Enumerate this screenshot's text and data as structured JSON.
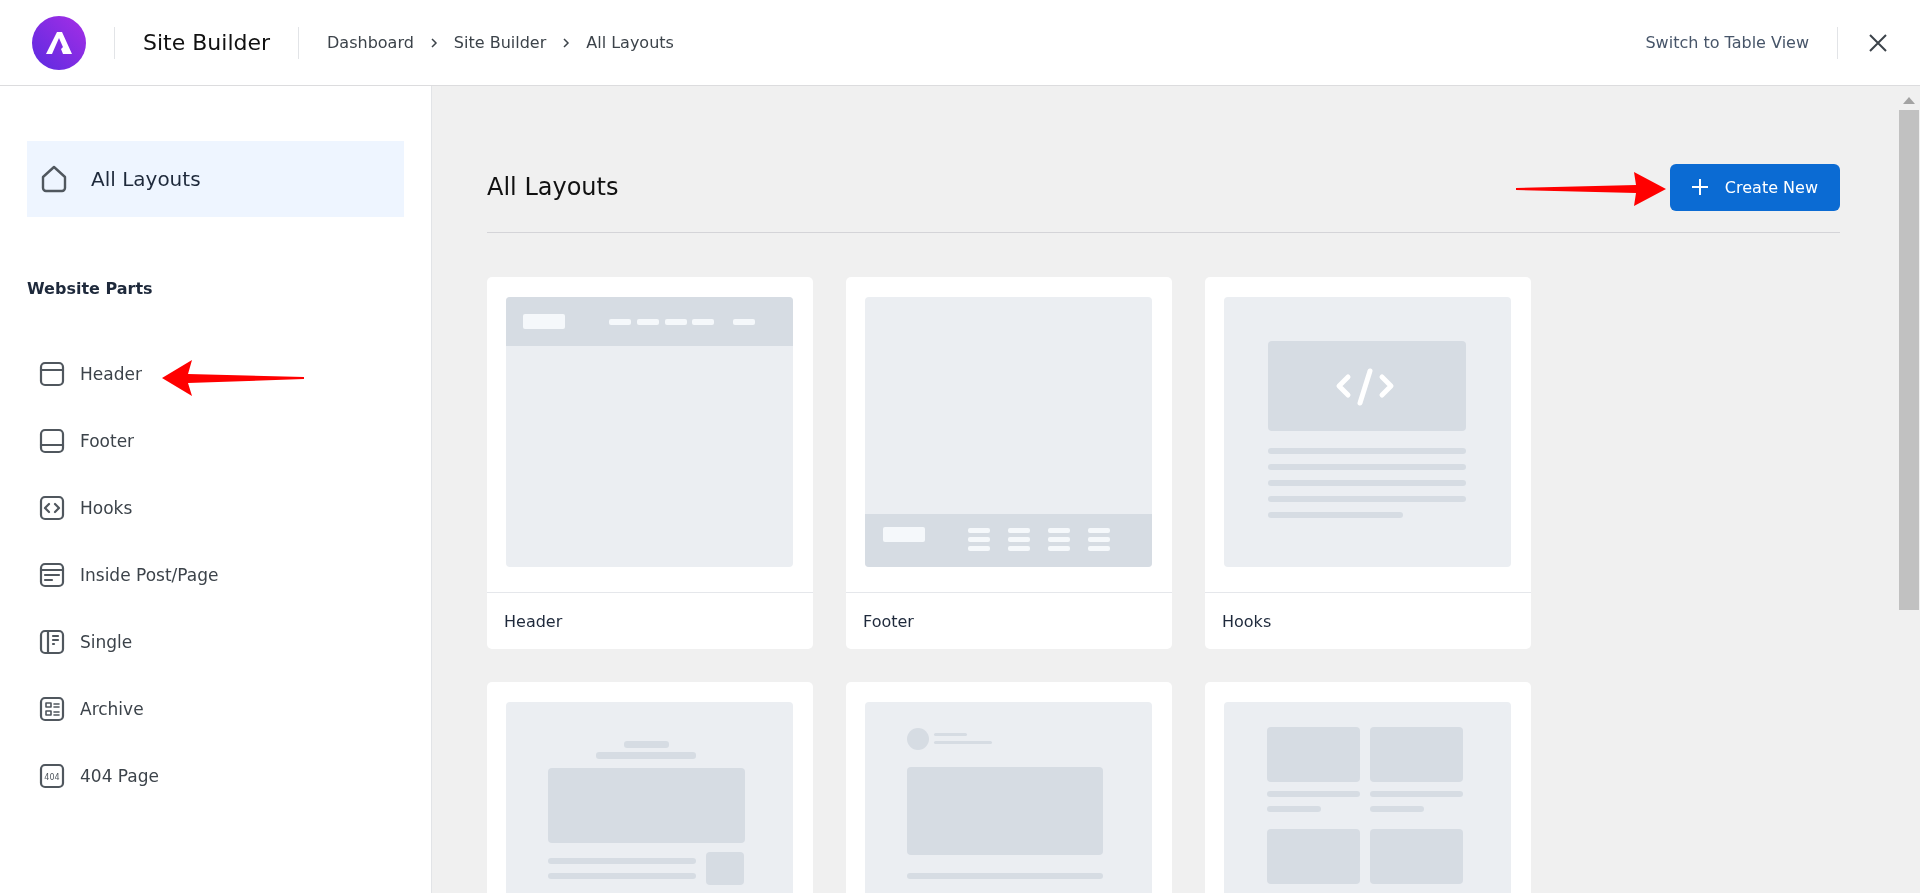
{
  "topbar": {
    "title": "Site Builder",
    "breadcrumbs": [
      {
        "label": "Dashboard"
      },
      {
        "label": "Site Builder"
      },
      {
        "label": "All Layouts"
      }
    ],
    "switch_view": "Switch to Table View"
  },
  "sidebar": {
    "home": {
      "label": "All Layouts",
      "selected": true
    },
    "section_title": "Website Parts",
    "items": [
      {
        "kind": "header",
        "label": "Header",
        "selected": false
      },
      {
        "kind": "footer",
        "label": "Footer",
        "selected": false
      },
      {
        "kind": "hooks",
        "label": "Hooks",
        "selected": false
      },
      {
        "kind": "inside",
        "label": "Inside Post/Page",
        "selected": false
      },
      {
        "kind": "single",
        "label": "Single",
        "selected": false
      },
      {
        "kind": "archive",
        "label": "Archive",
        "selected": false
      },
      {
        "kind": "notfound",
        "label": "404 Page",
        "badge": "404",
        "selected": false
      }
    ]
  },
  "main": {
    "title": "All Layouts",
    "create_button": "Create New",
    "cards": [
      {
        "kind": "header",
        "label": "Header"
      },
      {
        "kind": "footer",
        "label": "Footer"
      },
      {
        "kind": "hooks",
        "label": "Hooks"
      },
      {
        "kind": "inside"
      },
      {
        "kind": "single"
      },
      {
        "kind": "archive"
      }
    ]
  }
}
